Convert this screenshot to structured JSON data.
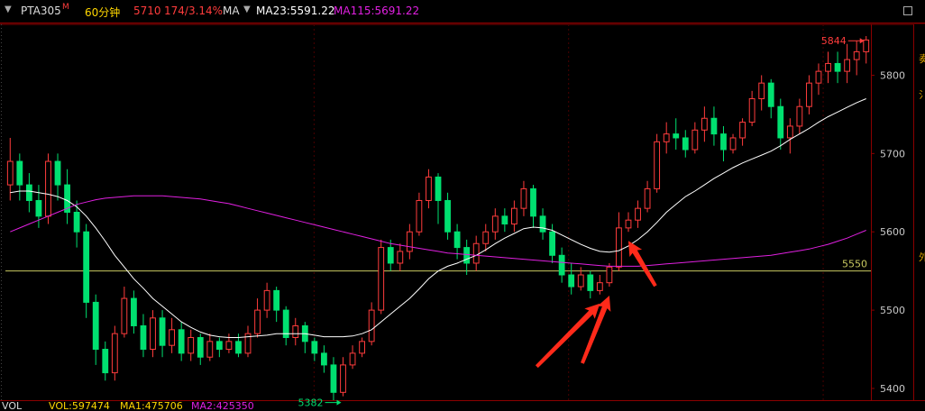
{
  "header": {
    "symbol": "PTA305",
    "symbol_mark": "M",
    "period": "60分钟",
    "price": "5710",
    "change": "174/3.14%",
    "indicator": "MA",
    "ma23": "MA23:5591.22",
    "ma115": "MA115:5691.22"
  },
  "footer": {
    "vol_label": "VOL",
    "vol": "VOL:597474",
    "ma1": "MA1:475706",
    "ma2": "MA2:425350"
  },
  "colors": {
    "up": "#ff3c3c",
    "down": "#00e070",
    "ma23": "#ffffff",
    "ma115": "#e020e0",
    "hline": "#c8c860",
    "axis_frame": "#8b0000",
    "arrow": "#ff2a1a"
  },
  "right_panel_chars": [
    "奏",
    "",
    "氵",
    "",
    "",
    "",
    "",
    "",
    "",
    "",
    "",
    "外"
  ],
  "chart_data": {
    "type": "candlestick",
    "ylim": [
      5385,
      5865
    ],
    "yticks": [
      5400,
      5500,
      5600,
      5700,
      5800
    ],
    "hline": {
      "value": 5550,
      "label": "5550"
    },
    "annotations": [
      {
        "label": "5844",
        "value": 5844,
        "bar": 90
      },
      {
        "label": "5382",
        "value": 5382,
        "bar": 35
      }
    ],
    "arrows_at_bars": [
      62,
      63,
      65
    ],
    "candles": [
      [
        5660,
        5690,
        5720,
        5640
      ],
      [
        5690,
        5660,
        5700,
        5640
      ],
      [
        5660,
        5640,
        5675,
        5625
      ],
      [
        5640,
        5620,
        5660,
        5605
      ],
      [
        5620,
        5690,
        5700,
        5610
      ],
      [
        5690,
        5660,
        5700,
        5640
      ],
      [
        5660,
        5625,
        5680,
        5610
      ],
      [
        5625,
        5600,
        5640,
        5580
      ],
      [
        5600,
        5510,
        5610,
        5490
      ],
      [
        5510,
        5450,
        5520,
        5430
      ],
      [
        5450,
        5420,
        5460,
        5410
      ],
      [
        5420,
        5470,
        5480,
        5410
      ],
      [
        5470,
        5515,
        5530,
        5465
      ],
      [
        5515,
        5480,
        5525,
        5470
      ],
      [
        5480,
        5450,
        5495,
        5440
      ],
      [
        5450,
        5490,
        5500,
        5440
      ],
      [
        5490,
        5455,
        5500,
        5440
      ],
      [
        5455,
        5475,
        5490,
        5445
      ],
      [
        5475,
        5445,
        5485,
        5435
      ],
      [
        5445,
        5465,
        5475,
        5435
      ],
      [
        5465,
        5440,
        5470,
        5430
      ],
      [
        5440,
        5460,
        5470,
        5435
      ],
      [
        5460,
        5450,
        5465,
        5440
      ],
      [
        5450,
        5460,
        5470,
        5445
      ],
      [
        5460,
        5445,
        5470,
        5440
      ],
      [
        5445,
        5470,
        5480,
        5440
      ],
      [
        5470,
        5500,
        5515,
        5465
      ],
      [
        5500,
        5525,
        5535,
        5490
      ],
      [
        5525,
        5500,
        5530,
        5485
      ],
      [
        5500,
        5465,
        5505,
        5455
      ],
      [
        5465,
        5480,
        5490,
        5455
      ],
      [
        5480,
        5460,
        5485,
        5445
      ],
      [
        5460,
        5445,
        5465,
        5435
      ],
      [
        5445,
        5430,
        5455,
        5420
      ],
      [
        5430,
        5395,
        5440,
        5385
      ],
      [
        5395,
        5430,
        5440,
        5390
      ],
      [
        5430,
        5445,
        5455,
        5425
      ],
      [
        5445,
        5460,
        5465,
        5440
      ],
      [
        5460,
        5500,
        5510,
        5455
      ],
      [
        5500,
        5580,
        5590,
        5495
      ],
      [
        5580,
        5560,
        5590,
        5550
      ],
      [
        5560,
        5575,
        5585,
        5550
      ],
      [
        5575,
        5600,
        5610,
        5565
      ],
      [
        5600,
        5640,
        5650,
        5595
      ],
      [
        5640,
        5670,
        5680,
        5630
      ],
      [
        5670,
        5640,
        5675,
        5610
      ],
      [
        5640,
        5600,
        5650,
        5590
      ],
      [
        5600,
        5580,
        5610,
        5565
      ],
      [
        5580,
        5560,
        5590,
        5545
      ],
      [
        5560,
        5585,
        5595,
        5550
      ],
      [
        5585,
        5600,
        5610,
        5575
      ],
      [
        5600,
        5620,
        5630,
        5590
      ],
      [
        5620,
        5610,
        5630,
        5600
      ],
      [
        5610,
        5630,
        5640,
        5600
      ],
      [
        5630,
        5655,
        5665,
        5620
      ],
      [
        5655,
        5620,
        5660,
        5605
      ],
      [
        5620,
        5600,
        5630,
        5590
      ],
      [
        5600,
        5570,
        5610,
        5560
      ],
      [
        5570,
        5545,
        5580,
        5535
      ],
      [
        5545,
        5530,
        5560,
        5520
      ],
      [
        5530,
        5545,
        5555,
        5525
      ],
      [
        5545,
        5525,
        5550,
        5515
      ],
      [
        5525,
        5535,
        5545,
        5520
      ],
      [
        5535,
        5555,
        5560,
        5530
      ],
      [
        5555,
        5605,
        5625,
        5550
      ],
      [
        5605,
        5615,
        5625,
        5600
      ],
      [
        5615,
        5630,
        5640,
        5605
      ],
      [
        5630,
        5655,
        5665,
        5625
      ],
      [
        5655,
        5715,
        5725,
        5650
      ],
      [
        5715,
        5725,
        5740,
        5700
      ],
      [
        5725,
        5720,
        5745,
        5705
      ],
      [
        5720,
        5705,
        5730,
        5695
      ],
      [
        5705,
        5730,
        5740,
        5700
      ],
      [
        5730,
        5745,
        5760,
        5715
      ],
      [
        5745,
        5725,
        5760,
        5710
      ],
      [
        5725,
        5705,
        5735,
        5690
      ],
      [
        5705,
        5720,
        5725,
        5700
      ],
      [
        5720,
        5740,
        5745,
        5710
      ],
      [
        5740,
        5770,
        5780,
        5735
      ],
      [
        5770,
        5790,
        5800,
        5755
      ],
      [
        5790,
        5760,
        5795,
        5745
      ],
      [
        5760,
        5720,
        5770,
        5705
      ],
      [
        5720,
        5735,
        5745,
        5700
      ],
      [
        5735,
        5760,
        5770,
        5725
      ],
      [
        5760,
        5790,
        5800,
        5750
      ],
      [
        5790,
        5805,
        5815,
        5775
      ],
      [
        5805,
        5815,
        5830,
        5790
      ],
      [
        5815,
        5805,
        5830,
        5790
      ],
      [
        5805,
        5820,
        5840,
        5790
      ],
      [
        5820,
        5830,
        5844,
        5800
      ],
      [
        5830,
        5845,
        5850,
        5815
      ]
    ],
    "ma23_values": [
      5650,
      5652,
      5652,
      5650,
      5648,
      5645,
      5640,
      5632,
      5620,
      5605,
      5588,
      5570,
      5555,
      5540,
      5528,
      5515,
      5505,
      5495,
      5485,
      5478,
      5472,
      5468,
      5466,
      5465,
      5465,
      5466,
      5467,
      5468,
      5470,
      5470,
      5470,
      5470,
      5468,
      5466,
      5466,
      5466,
      5467,
      5470,
      5475,
      5485,
      5495,
      5505,
      5515,
      5527,
      5540,
      5550,
      5556,
      5560,
      5565,
      5570,
      5577,
      5585,
      5592,
      5598,
      5604,
      5606,
      5605,
      5602,
      5596,
      5590,
      5584,
      5579,
      5575,
      5574,
      5576,
      5582,
      5590,
      5600,
      5612,
      5625,
      5635,
      5645,
      5652,
      5660,
      5668,
      5675,
      5682,
      5688,
      5693,
      5698,
      5703,
      5710,
      5718,
      5725,
      5732,
      5740,
      5747,
      5753,
      5759,
      5765,
      5770
    ],
    "ma115_values": [
      5600,
      5605,
      5610,
      5615,
      5620,
      5625,
      5630,
      5635,
      5638,
      5641,
      5643,
      5644,
      5645,
      5646,
      5646,
      5646,
      5646,
      5645,
      5644,
      5643,
      5642,
      5640,
      5638,
      5636,
      5633,
      5630,
      5627,
      5624,
      5621,
      5618,
      5615,
      5612,
      5609,
      5606,
      5603,
      5600,
      5597,
      5594,
      5591,
      5588,
      5585,
      5583,
      5581,
      5579,
      5577,
      5575,
      5573,
      5572,
      5571,
      5570,
      5569,
      5568,
      5567,
      5566,
      5565,
      5564,
      5563,
      5562,
      5561,
      5560,
      5559,
      5558,
      5557,
      5556,
      5556,
      5556,
      5556,
      5557,
      5558,
      5559,
      5560,
      5561,
      5562,
      5563,
      5564,
      5565,
      5566,
      5567,
      5568,
      5569,
      5570,
      5572,
      5574,
      5576,
      5578,
      5581,
      5584,
      5588,
      5592,
      5597,
      5602
    ]
  }
}
